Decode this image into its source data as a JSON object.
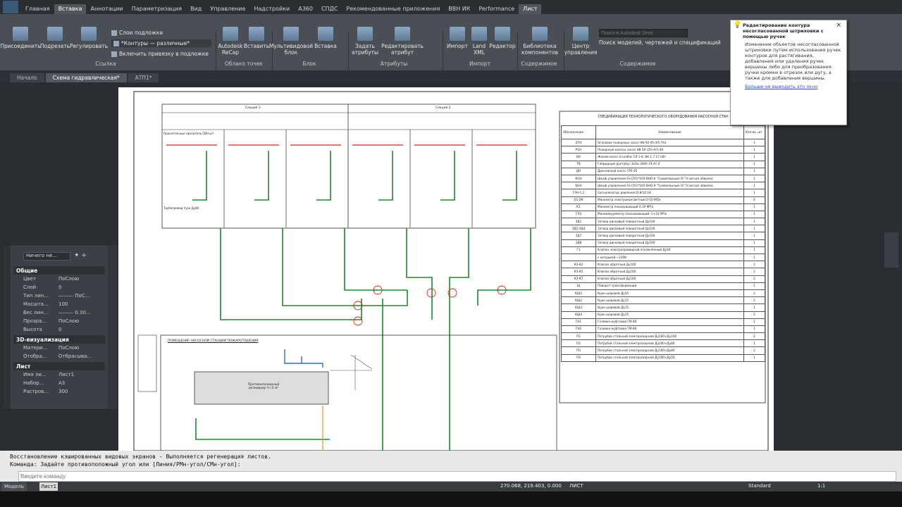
{
  "menu_tabs": [
    "Главная",
    "Вставка",
    "Аннотации",
    "Параметризация",
    "Вид",
    "Управление",
    "Надстройки",
    "A360",
    "СПДС",
    "Рекомендованные приложения",
    "ВВН ИК",
    "Performance",
    "Лист"
  ],
  "ribbon": {
    "buttons": [
      "Присоединить",
      "Подрезать",
      "Регулировать",
      "Autodesk ReCap",
      "Вставить",
      "Мультивидовой блок",
      "Вставка",
      "Задать атрибуты",
      "Редактировать атрибут",
      "Импорт",
      "Land XML",
      "Редактор",
      "Библиотека компонентов",
      "Центр управления"
    ],
    "small_items": [
      "Слои подложки",
      "*Контуры — различные*",
      "Включить привязку в подложке"
    ],
    "groups": [
      "Ссылка",
      "Облако точек",
      "Блок",
      "Атрибуты",
      "Импорт",
      "Содержимое",
      "Содержимое"
    ],
    "search_placeholder": "Поиск в Autodesk Seek",
    "search_label": "Поиск моделей, чертежей и спецификаций"
  },
  "doc_tabs": [
    "Начало",
    "Схема гидравлическая*",
    "АТП1*"
  ],
  "tooltip": {
    "title": "Редактирование контура несогласованной штриховки с помощью ручек",
    "body": "Изменение объектов несогласованной штриховки путем использования ручек контуров для растягивания, добавления или удаления ручек вершины либо для преобразования ручки кромки в отрезок или дугу, а также для добавления вершины.",
    "link": "Больше не выводить это окно"
  },
  "properties": {
    "selector": "Ничего не...",
    "sections": [
      {
        "title": "Общие",
        "rows": [
          [
            "Цвет",
            "ПоСлою"
          ],
          [
            "Слой",
            "0"
          ],
          [
            "Тип лин...",
            "——— ПоС..."
          ],
          [
            "Масшта...",
            "100"
          ],
          [
            "Вес лин...",
            "——— 0.30..."
          ],
          [
            "Прозра...",
            "ПоСлою"
          ],
          [
            "Высота",
            "0"
          ]
        ]
      },
      {
        "title": "3D-визуализация",
        "rows": [
          [
            "Матери...",
            "ПоСлою"
          ],
          [
            "Отобра...",
            "Отбрасыва..."
          ]
        ]
      },
      {
        "title": "Лист",
        "rows": [
          [
            "Имя ли...",
            "Лист1"
          ],
          [
            "Набор...",
            "A3"
          ],
          [
            "Растров...",
            "300"
          ]
        ]
      }
    ]
  },
  "drawing": {
    "spec_title": "СПЕЦИФИКАЦИЯ ТЕХНОЛОГИЧЕСКОГО ОБОРУДОВАНИЯ НАСОСНОЙ СТАН",
    "spec_headers": [
      "Обозначение",
      "Наименование",
      "Кол-во, шт."
    ],
    "spec_rows": [
      [
        "DТН",
        "Оголовок пожарных насос НВ-50-05-4/5-7А1",
        "1"
      ],
      [
        "Р1Н",
        "Пожарные насосы насос НВ 50-155-4/5-ЭА",
        "1"
      ],
      [
        "ВН",
        "Жокей-насос Grundfos CR 1-8, ВК 1.7,17 кВт",
        "1"
      ],
      [
        "ТВ",
        "Гибридный дуктубус 3x5м 3000-74-4С 4",
        "1"
      ],
      [
        "ДН",
        "Дренажный насос СРS-45",
        "1"
      ],
      [
        "Ф1Н",
        "Шкаф управления IS-CR1/*165-ВНО.К \"Гримизерный-ЗС\"Э сигнал обвалка",
        "1"
      ],
      [
        "Ф2Н",
        "Шкаф управления IS-CR1/*165-ВНО.К \"Гримизерный-ЗС\"Э сигнал обвалка",
        "1"
      ],
      [
        "ГРН-1,2",
        "Сигнализатор давления D-8/10-18",
        "1"
      ],
      [
        "D1-D6",
        "Манометр электроконтактный 0-10 МПа",
        "6"
      ],
      [
        "K1",
        "Манометр показывающий 0-10 МПа",
        "1"
      ],
      [
        "ГЛ2",
        "Мановакуумметр показывающий -1+10 МПа",
        "1"
      ],
      [
        "ЗД1",
        "Затвор дисковый поворотный Ду100",
        "1"
      ],
      [
        "ЗД2-ЗД4",
        "Затвор дисковый поворотный Ду100",
        "1"
      ],
      [
        "ЗД7",
        "Затвор дисковый поворотный Ду100",
        "1"
      ],
      [
        "ЗД8",
        "Затвор дисковый поворотный Ду100",
        "1"
      ],
      [
        "Г1",
        "Клапан электроприводной отключённый Ду50",
        "1"
      ],
      [
        "",
        "с катушкой ~220В",
        "1"
      ],
      [
        "КЗ-К2",
        "Клапан обратный Ду100",
        "2"
      ],
      [
        "КЗ-К5",
        "Клапан обратный Ду100",
        "2"
      ],
      [
        "КЗ-К7",
        "Клапан обратный Ду100",
        "2"
      ],
      [
        "Ш",
        "Поворот трансформации",
        "1"
      ],
      [
        "КШ1",
        "Кран шаровой Ду50",
        "2"
      ],
      [
        "КШ2",
        "Кран шаровой Ду15",
        "2"
      ],
      [
        "КШ3",
        "Кран шаровой Ду15",
        "1"
      ],
      [
        "КШ4",
        "Кран шаровой Ду15",
        "2"
      ],
      [
        "ГН1",
        "Головка муфтовая ГМ-80",
        "1"
      ],
      [
        "ГН2",
        "Головка муфтовая ГМ-80",
        "1"
      ],
      [
        "П1",
        "Патрубок стальной электросварной Ду100×Ду100",
        "2"
      ],
      [
        "П2",
        "Патрубок стальной электросварной Ду100×Ду80",
        "1"
      ],
      [
        "П3",
        "Патрубок стальной электросварной Ду100×Ду80",
        "2"
      ],
      [
        "П4",
        "Патрубок стальной электросварной Ду100×Ду50",
        "1"
      ]
    ],
    "section1_label": "Секция 1",
    "section2_label": "Секция 2",
    "sprinkler_label": "Оросительные ороситель СВН шт.",
    "main_label": "Трубопровод пуск Ду80",
    "tank_label": "Противопожарный резервуар V=5 м³",
    "pump_label": "ПОМЕЩЕНИЕ НАСОСНОЙ СТАНЦИИ ПОЖАРОТУШЕНИЯ"
  },
  "command": {
    "line1": "Восстановление кэшированных видовых экранов - Выполняется регенерация листов.",
    "line2": "Команда: Задайте противоположный угол или [Линия/РМн-угол/СМн-угол]:",
    "input_placeholder": "Введите команду"
  },
  "status": {
    "coords": "270.068, 219.403, 0.000",
    "mode": "ЛИСТ",
    "annotation": "Standard",
    "scale": "1:1"
  },
  "layout_tabs": [
    "Модель",
    "Лист1"
  ]
}
